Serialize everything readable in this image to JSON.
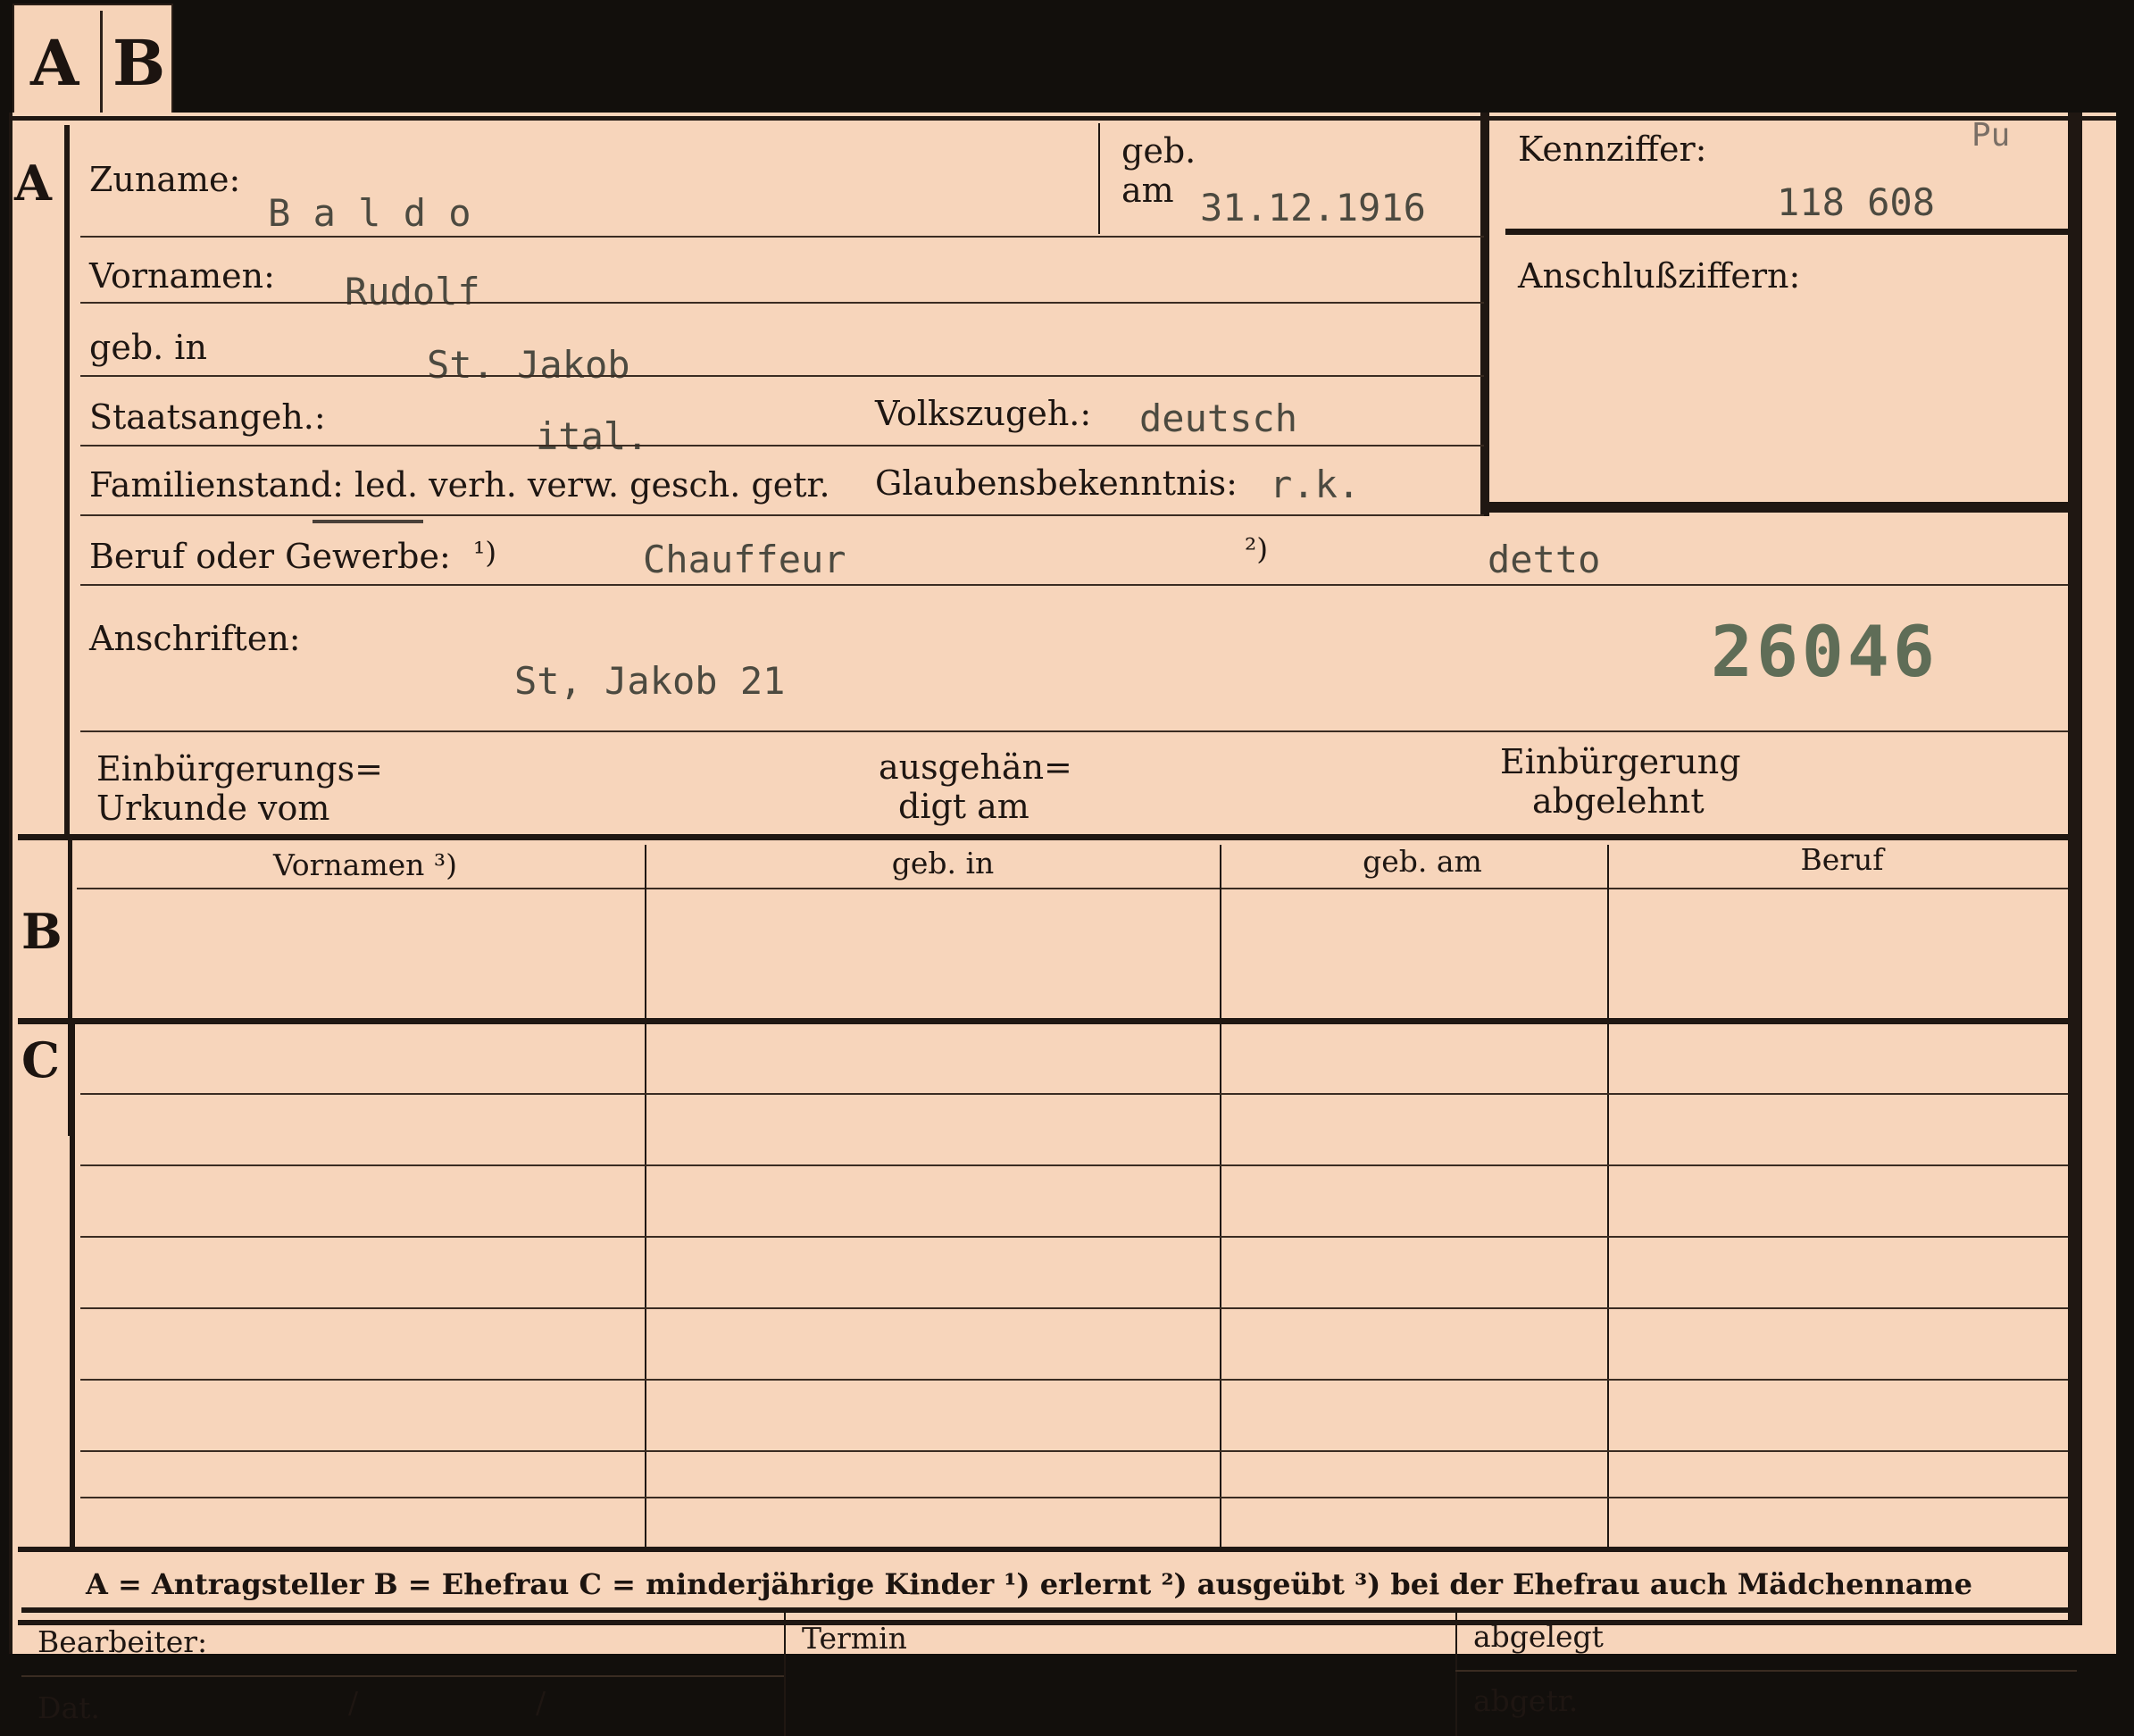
{
  "tabs": {
    "a": "A",
    "b": "B"
  },
  "sections": {
    "a": "A",
    "b": "B",
    "c": "C"
  },
  "labels": {
    "zuname": "Zuname:",
    "geb": "geb.",
    "am": "am",
    "vornamen": "Vornamen:",
    "geb_in": "geb. in",
    "staatsangeh": "Staatsangeh.:",
    "volkszugeh": "Volkszugeh.:",
    "familienstand": "Familienstand: led. verh. verw. gesch. getr.",
    "glaubensbekenntnis": "Glaubensbekenntnis:",
    "beruf": "Beruf oder Gewerbe:",
    "beruf_note1": "¹)",
    "beruf_note2": "²)",
    "anschriften": "Anschriften:",
    "kennziffer": "Kennziffer:",
    "anschlussziffern": "Anschlußziffern:",
    "einbuergerungs_1": "Einbürgerungs=",
    "einbuergerungs_2": "Urkunde vom",
    "ausgehaen_1": "ausgehän=",
    "ausgehaen_2": "digt am",
    "einbuergerung_1": "Einbürgerung",
    "einbuergerung_2": "abgelehnt"
  },
  "values": {
    "zuname": "B a l d o",
    "geb_am": "31.12.1916",
    "vornamen": "Rudolf",
    "geb_in": "St. Jakob",
    "staatsangeh": "ital.",
    "volkszugeh": "deutsch",
    "glaubensbekenntnis": "r.k.",
    "beruf_erlernt": "Chauffeur",
    "beruf_ausgeuebt": "detto",
    "anschrift": "St, Jakob 21",
    "kennziffer_note": "Pu",
    "kennziffer": "118 608",
    "stamp_number": "26046"
  },
  "table": {
    "columns": [
      "Vornamen ³)",
      "geb. in",
      "geb. am",
      "Beruf"
    ]
  },
  "legend": "A = Antragsteller   B = Ehefrau   C = minderjährige Kinder   ¹) erlernt   ²) ausgeübt   ³) bei der Ehefrau auch Mädchenname",
  "footer": {
    "bearbeiter": "Bearbeiter:",
    "dat": "Dat.",
    "slash1": "/",
    "slash2": "/",
    "termin": "Termin",
    "abgelegt": "abgelegt",
    "abgetr": "abgetr."
  },
  "colors": {
    "card": "#f7d5bb",
    "ink": "#1e1612",
    "typewriter": "#4c4a40",
    "stamp": "#5f6d57"
  }
}
